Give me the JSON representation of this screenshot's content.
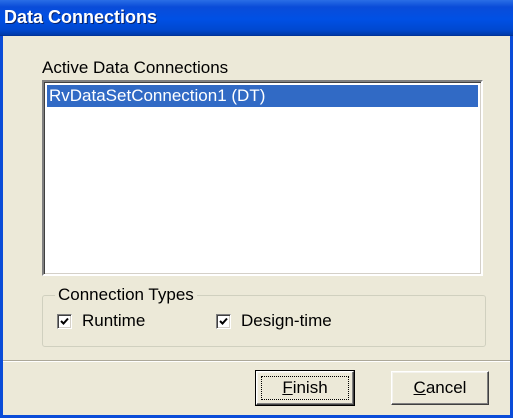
{
  "window": {
    "title": "Data Connections"
  },
  "connections": {
    "label": "Active Data Connections",
    "items": [
      {
        "label": "RvDataSetConnection1 (DT)",
        "selected": true
      }
    ]
  },
  "connection_types": {
    "legend": "Connection Types",
    "runtime": {
      "label": "Runtime",
      "checked": true
    },
    "design_time": {
      "label": "Design-time",
      "checked": true
    }
  },
  "buttons": {
    "finish": {
      "mnemonic": "F",
      "rest": "inish"
    },
    "cancel": {
      "mnemonic": "C",
      "rest": "ancel"
    }
  },
  "colors": {
    "title_bar": "#0050e5",
    "selection": "#316ac5",
    "dialog_bg": "#ece9d8"
  },
  "icons": {
    "checkmark": "check-icon"
  }
}
